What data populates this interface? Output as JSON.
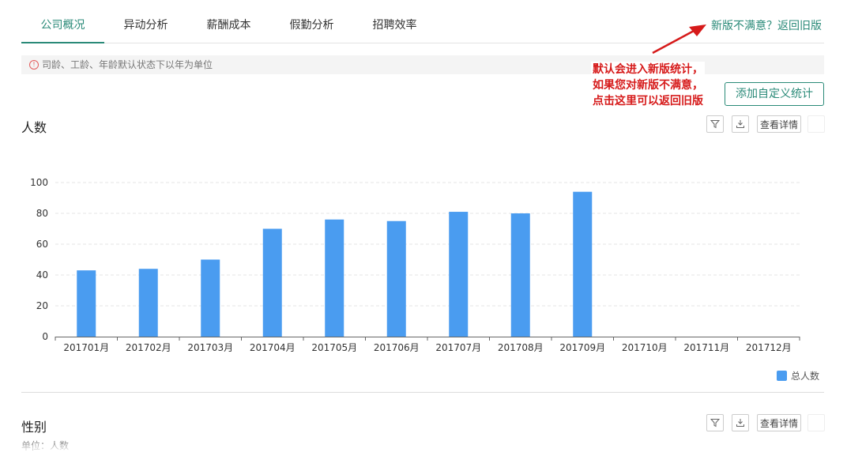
{
  "tabs": [
    {
      "label": "公司概况",
      "active": true
    },
    {
      "label": "异动分析",
      "active": false
    },
    {
      "label": "薪酬成本",
      "active": false
    },
    {
      "label": "假勤分析",
      "active": false
    },
    {
      "label": "招聘效率",
      "active": false
    }
  ],
  "old_version_link": "新版不满意？返回旧版",
  "notice": "司龄、工龄、年龄默认状态下以年为单位",
  "annotation": [
    "默认会进入新版统计，",
    "如果您对新版不满意，",
    "点击这里可以返回旧版"
  ],
  "add_button": "添加自定义统计",
  "sections": [
    {
      "title": "人数",
      "detail_label": "查看详情"
    },
    {
      "title": "性别",
      "detail_label": "查看详情",
      "unit": "单位：人数"
    }
  ],
  "colors": {
    "accent": "#2a8a78",
    "bar": "#4a9cf0",
    "annotation": "#d61a1a"
  },
  "chart_data": {
    "type": "bar",
    "categories": [
      "201701月",
      "201702月",
      "201703月",
      "201704月",
      "201705月",
      "201706月",
      "201707月",
      "201708月",
      "201709月",
      "201710月",
      "201711月",
      "201712月"
    ],
    "series": [
      {
        "name": "总人数",
        "values": [
          43,
          44,
          50,
          70,
          76,
          75,
          81,
          80,
          94,
          null,
          null,
          null
        ]
      }
    ],
    "yticks": [
      0,
      20,
      40,
      60,
      80,
      100
    ],
    "ylim": [
      0,
      100
    ],
    "grid": true,
    "legend": "bottom-right"
  }
}
